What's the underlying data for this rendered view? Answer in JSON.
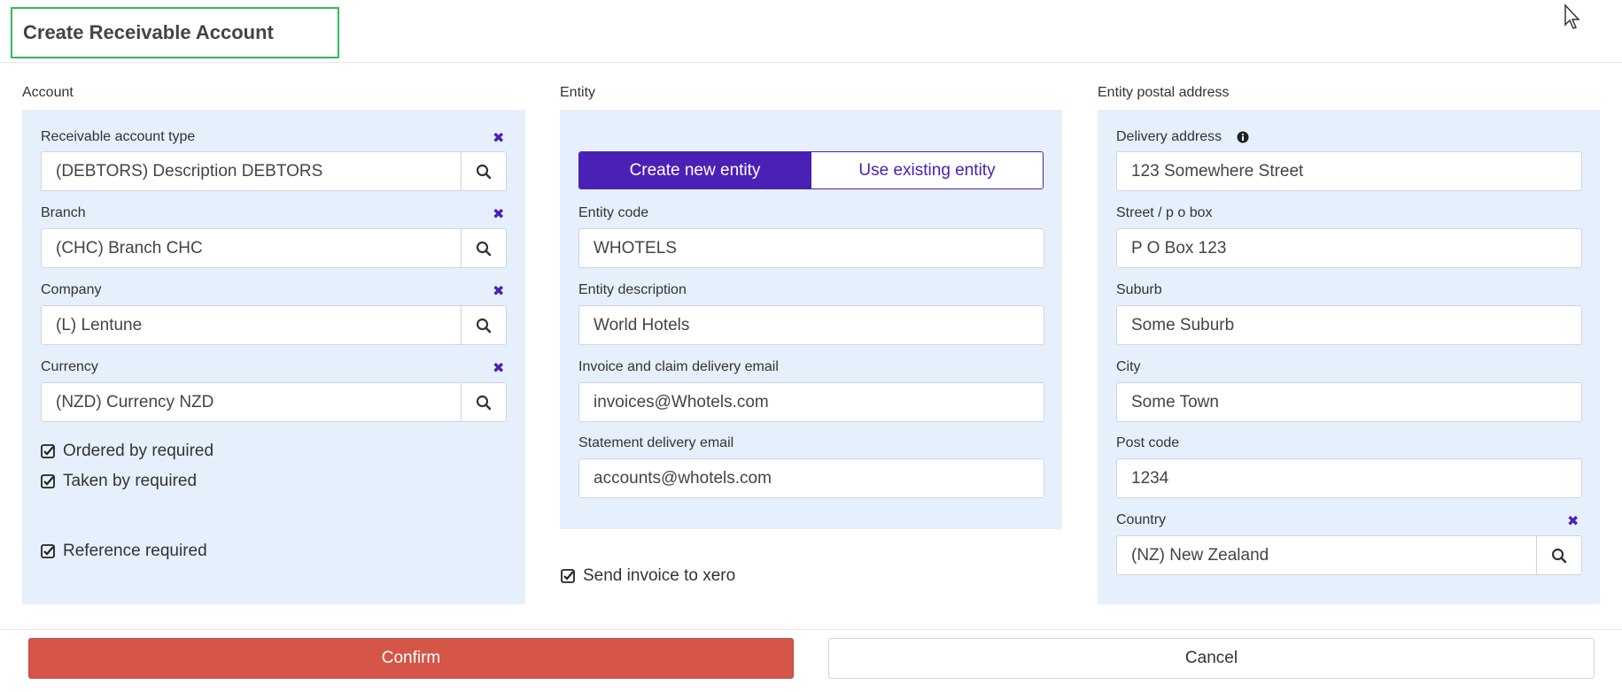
{
  "dialog": {
    "title": "Create Receivable Account"
  },
  "account": {
    "section_title": "Account",
    "receivable_type": {
      "label": "Receivable account type",
      "value": "(DEBTORS) Description DEBTORS"
    },
    "branch": {
      "label": "Branch",
      "value": "(CHC) Branch CHC"
    },
    "company": {
      "label": "Company",
      "value": "(L) Lentune"
    },
    "currency": {
      "label": "Currency",
      "value": "(NZD) Currency NZD"
    },
    "ordered_by": {
      "label": "Ordered by required",
      "checked": true
    },
    "taken_by": {
      "label": "Taken by required",
      "checked": true
    },
    "reference": {
      "label": "Reference required",
      "checked": true
    }
  },
  "entity": {
    "section_title": "Entity",
    "toggle": {
      "create_label": "Create new entity",
      "existing_label": "Use existing entity",
      "selected": "create"
    },
    "code": {
      "label": "Entity code",
      "value": "WHOTELS"
    },
    "description": {
      "label": "Entity description",
      "value": "World Hotels"
    },
    "invoice_email": {
      "label": "Invoice and claim delivery email",
      "value": "invoices@Whotels.com"
    },
    "statement_email": {
      "label": "Statement delivery email",
      "value": "accounts@whotels.com"
    },
    "send_xero": {
      "label": "Send invoice to xero",
      "checked": true
    }
  },
  "address": {
    "section_title": "Entity postal address",
    "delivery": {
      "label": "Delivery address",
      "value": "123 Somewhere Street"
    },
    "street": {
      "label": "Street / p o box",
      "value": "P O Box 123"
    },
    "suburb": {
      "label": "Suburb",
      "value": "Some Suburb"
    },
    "city": {
      "label": "City",
      "value": "Some Town"
    },
    "postcode": {
      "label": "Post code",
      "value": "1234"
    },
    "country": {
      "label": "Country",
      "value": "(NZ) New Zealand"
    }
  },
  "footer": {
    "confirm_label": "Confirm",
    "cancel_label": "Cancel"
  },
  "colors": {
    "accent": "#4b20b5",
    "panel": "#e6f0fc",
    "confirm": "#d55548",
    "title_border": "#2ebd59"
  },
  "icons": {
    "clear": "close-icon",
    "search": "search-icon",
    "check": "checkbox-checked-icon",
    "info": "info-icon"
  }
}
